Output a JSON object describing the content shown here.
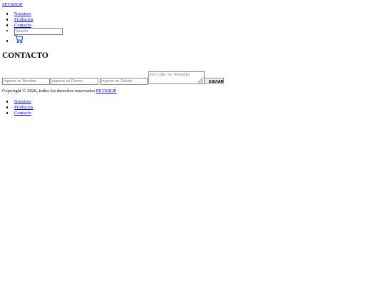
{
  "header": {
    "brand": "PETSHOP",
    "nav": [
      "Nosotros",
      "Productos",
      "Contacto"
    ],
    "search": {
      "placeholder": "Search",
      "value": ""
    },
    "cart_icon": "cart-icon"
  },
  "contact": {
    "title": "CONTACTO",
    "name_placeholder": "Ingrese su Nombre",
    "email_placeholder": "Ingrese su Correo",
    "phone_placeholder": "Ingrese su Celular",
    "message_placeholder": "Escriba su Mensaje",
    "send_label": "ENVIAR"
  },
  "footer": {
    "copyright": "Copyright © 2020, todos los derechos reservados",
    "brand": "PETSHOP",
    "nav": [
      "Nosotros",
      "Productos",
      "Contacto"
    ]
  },
  "colors": {
    "link": "#0000ee",
    "text": "#000000",
    "background": "#ffffff"
  }
}
